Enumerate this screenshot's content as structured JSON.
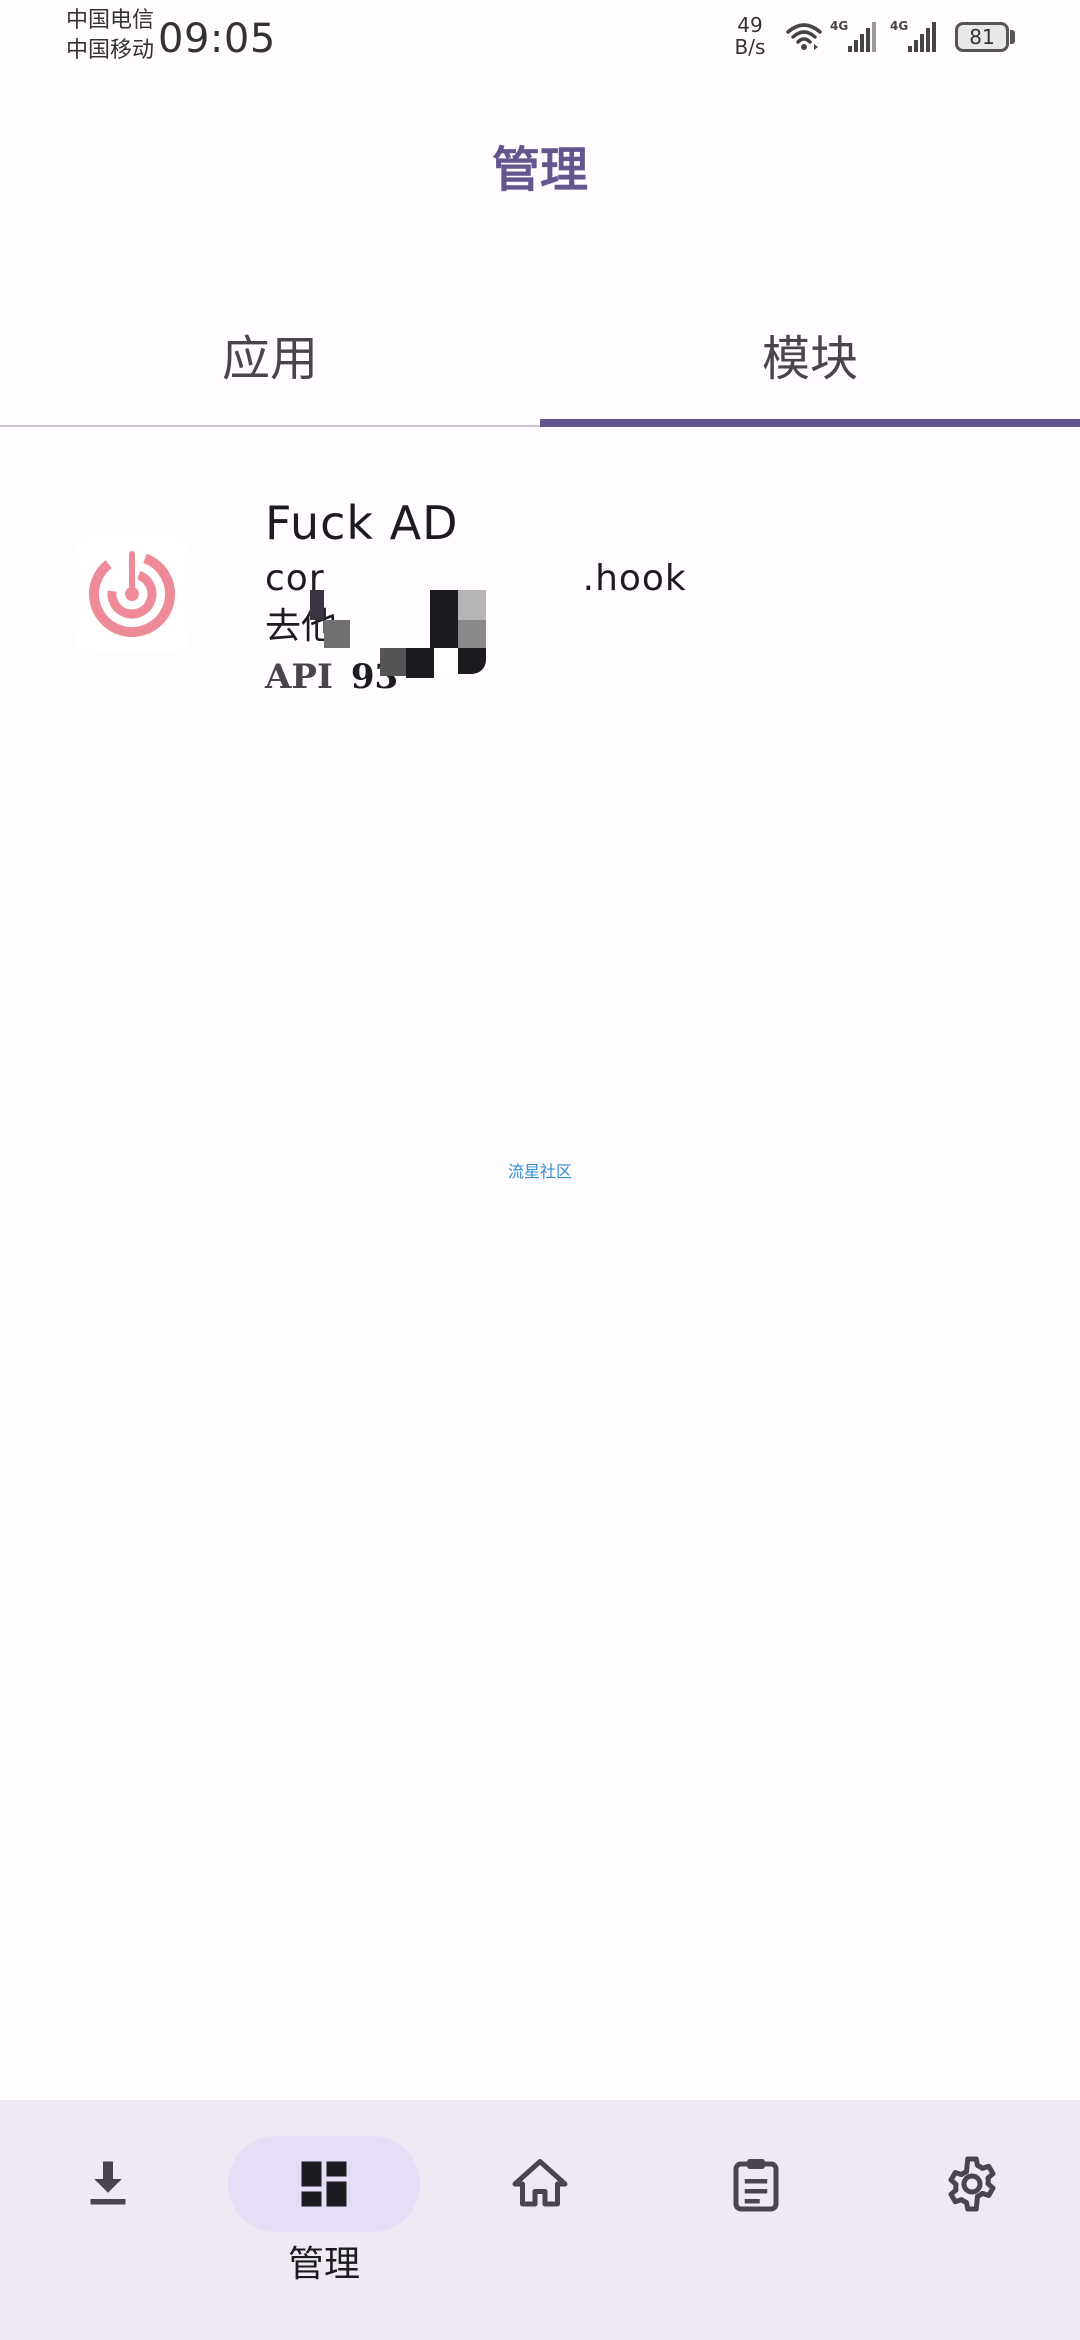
{
  "status_bar": {
    "carrier1": "中国电信",
    "carrier2": "中国移动",
    "time": "09:05",
    "net_speed_value": "49",
    "net_speed_unit": "B/s",
    "signal_label": "4G",
    "battery": "81"
  },
  "header": {
    "title": "管理"
  },
  "tabs": [
    {
      "label": "应用",
      "selected": false
    },
    {
      "label": "模块",
      "selected": true
    }
  ],
  "modules": [
    {
      "name": "Fuck AD",
      "package": "cor",
      "package_suffix": ".hook",
      "description": "去他",
      "api_label": "API",
      "api_version": "93",
      "icon": "radar-target-icon",
      "icon_color": "#EF8A99"
    }
  ],
  "watermark": "流星社区",
  "bottom_nav": {
    "items": [
      {
        "icon": "download-icon",
        "label": ""
      },
      {
        "icon": "dashboard-icon",
        "label": "管理",
        "active": true
      },
      {
        "icon": "home-icon",
        "label": ""
      },
      {
        "icon": "clipboard-icon",
        "label": ""
      },
      {
        "icon": "gear-icon",
        "label": ""
      }
    ]
  },
  "colors": {
    "accent": "#65558F",
    "background": "#FFFBFE",
    "nav_background": "#EFE9F3",
    "nav_active_pill": "#E6DDF6"
  }
}
